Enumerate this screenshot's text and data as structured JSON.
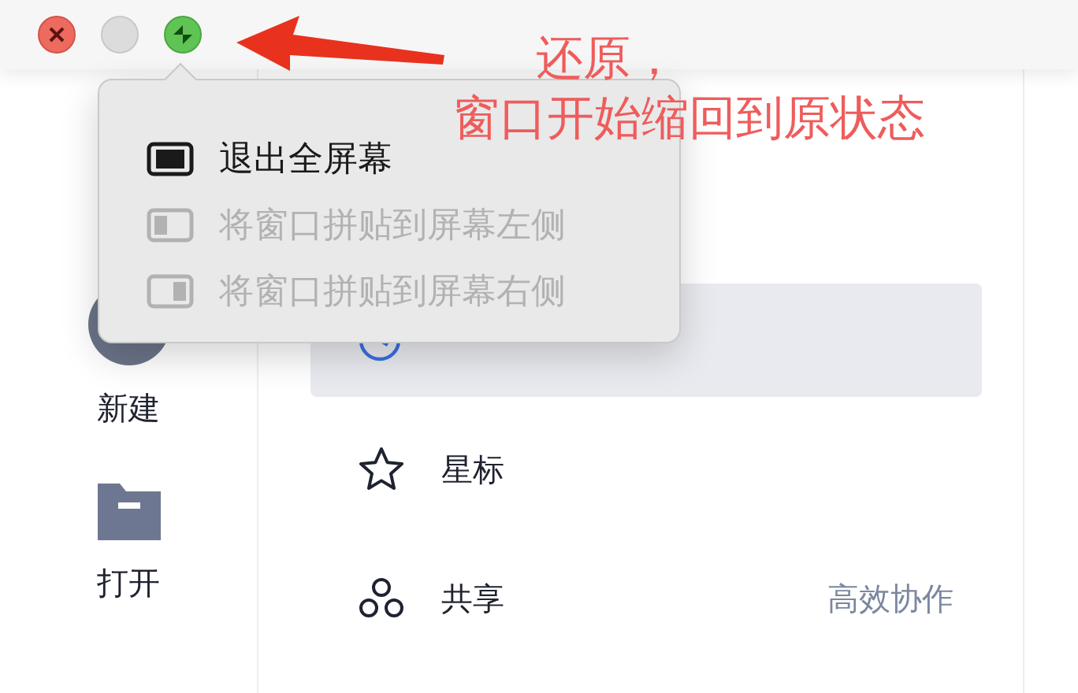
{
  "window": {
    "controls": [
      {
        "kind": "close",
        "disabled": false
      },
      {
        "kind": "minimize",
        "disabled": true
      },
      {
        "kind": "zoom",
        "disabled": false
      }
    ]
  },
  "menu": {
    "items": [
      {
        "label": "退出全屏幕",
        "kind": "full",
        "disabled": false
      },
      {
        "label": "将窗口拼贴到屏幕左侧",
        "kind": "left",
        "disabled": true
      },
      {
        "label": "将窗口拼贴到屏幕右侧",
        "kind": "right",
        "disabled": true
      }
    ]
  },
  "sidebar": {
    "actions": [
      {
        "label": "新建",
        "kind": "new"
      },
      {
        "label": "打开",
        "kind": "open"
      }
    ]
  },
  "nav": {
    "items": [
      {
        "kind": "recent",
        "selected": true
      },
      {
        "label": "星标",
        "kind": "star",
        "selected": false
      },
      {
        "label": "共享",
        "kind": "share",
        "selected": false,
        "hint": "高效协作"
      }
    ]
  },
  "annotation": {
    "lines": [
      "还原，",
      "窗口开始缩回到原状态"
    ]
  }
}
